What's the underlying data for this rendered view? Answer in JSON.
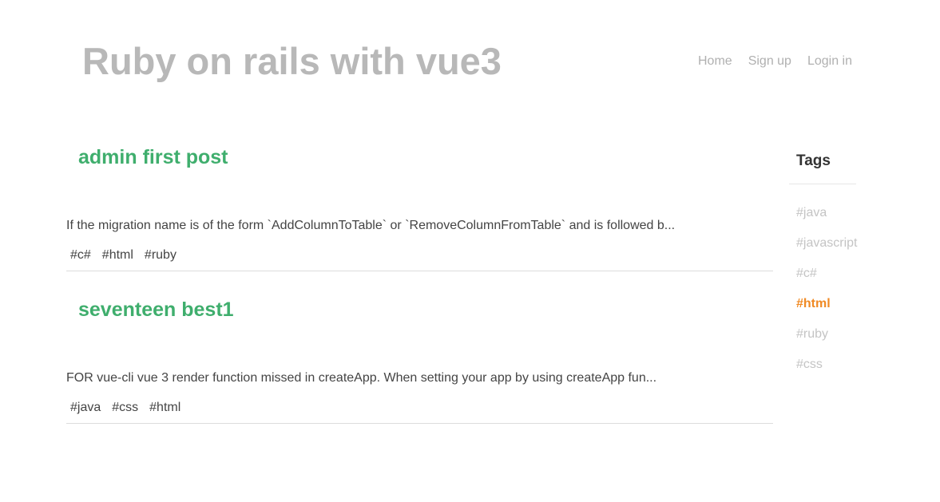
{
  "header": {
    "site_title": "Ruby on rails with vue3",
    "nav": [
      {
        "label": "Home"
      },
      {
        "label": "Sign up"
      },
      {
        "label": "Login in"
      }
    ]
  },
  "posts": [
    {
      "title": "admin first post",
      "excerpt": "If the migration name is of the form `AddColumnToTable` or `RemoveColumnFromTable` and is followed b...",
      "tags": [
        "#c#",
        "#html",
        "#ruby"
      ]
    },
    {
      "title": "seventeen best1",
      "excerpt": "FOR vue-cli vue 3 render function missed in createApp. When setting your app by using createApp fun...",
      "tags": [
        "#java",
        "#css",
        "#html"
      ]
    }
  ],
  "sidebar": {
    "title": "Tags",
    "tags": [
      {
        "label": "#java",
        "active": false
      },
      {
        "label": "#javascript",
        "active": false
      },
      {
        "label": "#c#",
        "active": false
      },
      {
        "label": "#html",
        "active": true
      },
      {
        "label": "#ruby",
        "active": false
      },
      {
        "label": "#css",
        "active": false
      }
    ],
    "active_color": "#f08a24",
    "inactive_color": "#c4c4c4"
  },
  "colors": {
    "title_gray": "#b8b8b8",
    "post_title_green": "#3fae6d"
  }
}
